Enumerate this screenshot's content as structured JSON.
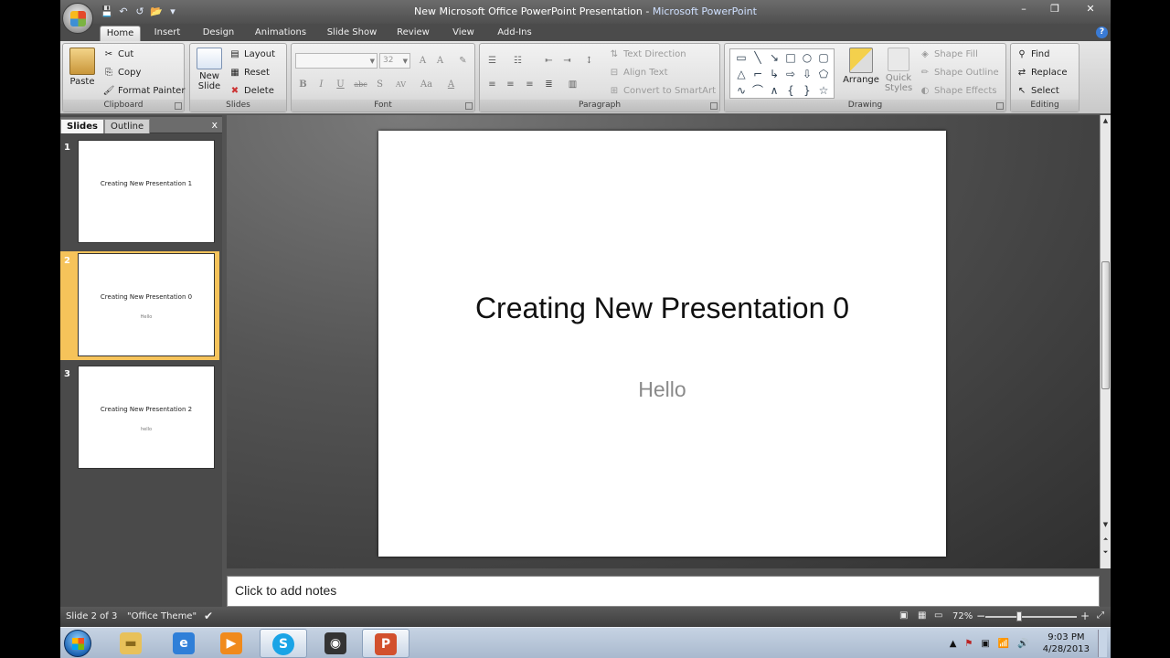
{
  "window": {
    "title_doc": "New Microsoft Office PowerPoint Presentation",
    "title_sep": " - ",
    "title_app": "Microsoft PowerPoint",
    "controls": {
      "minimize": "–",
      "restore": "❐",
      "close": "✕"
    }
  },
  "qat": {
    "save": "💾",
    "undo": "↶",
    "redo": "↺",
    "open": "📂",
    "customize": "▾"
  },
  "tabs": [
    "Home",
    "Insert",
    "Design",
    "Animations",
    "Slide Show",
    "Review",
    "View",
    "Add-Ins"
  ],
  "active_tab": "Home",
  "ribbon": {
    "clipboard": {
      "label": "Clipboard",
      "paste": "Paste",
      "cut": "Cut",
      "copy": "Copy",
      "format_painter": "Format Painter"
    },
    "slides": {
      "label": "Slides",
      "new_slide_1": "New",
      "new_slide_2": "Slide",
      "layout": "Layout",
      "reset": "Reset",
      "delete": "Delete"
    },
    "font": {
      "label": "Font",
      "font_name": "",
      "font_size": "32"
    },
    "paragraph": {
      "label": "Paragraph",
      "text_direction": "Text Direction",
      "align_text": "Align Text",
      "convert_smartart": "Convert to SmartArt"
    },
    "drawing": {
      "label": "Drawing",
      "arrange": "Arrange",
      "quick_styles_1": "Quick",
      "quick_styles_2": "Styles",
      "shape_fill": "Shape Fill",
      "shape_outline": "Shape Outline",
      "shape_effects": "Shape Effects"
    },
    "editing": {
      "label": "Editing",
      "find": "Find",
      "replace": "Replace",
      "select": "Select"
    }
  },
  "pane": {
    "tab_slides": "Slides",
    "tab_outline": "Outline",
    "close": "x",
    "thumbnails": [
      {
        "num": "1",
        "title": "Creating New Presentation 1",
        "subtitle": ""
      },
      {
        "num": "2",
        "title": "Creating New Presentation 0",
        "subtitle": "Hello"
      },
      {
        "num": "3",
        "title": "Creating New Presentation 2",
        "subtitle": "hello"
      }
    ],
    "selected_index": 2
  },
  "slide": {
    "title": "Creating New Presentation 0",
    "subtitle": "Hello"
  },
  "notes": {
    "placeholder": "Click to add notes"
  },
  "status": {
    "slide_info": "Slide 2 of 3",
    "theme": "\"Office Theme\"",
    "zoom": "72%",
    "zoom_minus": "−",
    "zoom_plus": "+"
  },
  "taskbar": {
    "time": "9:03 PM",
    "date": "4/28/2013"
  },
  "colors": {
    "accent_selected": "#f6c35a",
    "ribbon_bg": "#dcdcdc",
    "window_bg": "#535353"
  }
}
